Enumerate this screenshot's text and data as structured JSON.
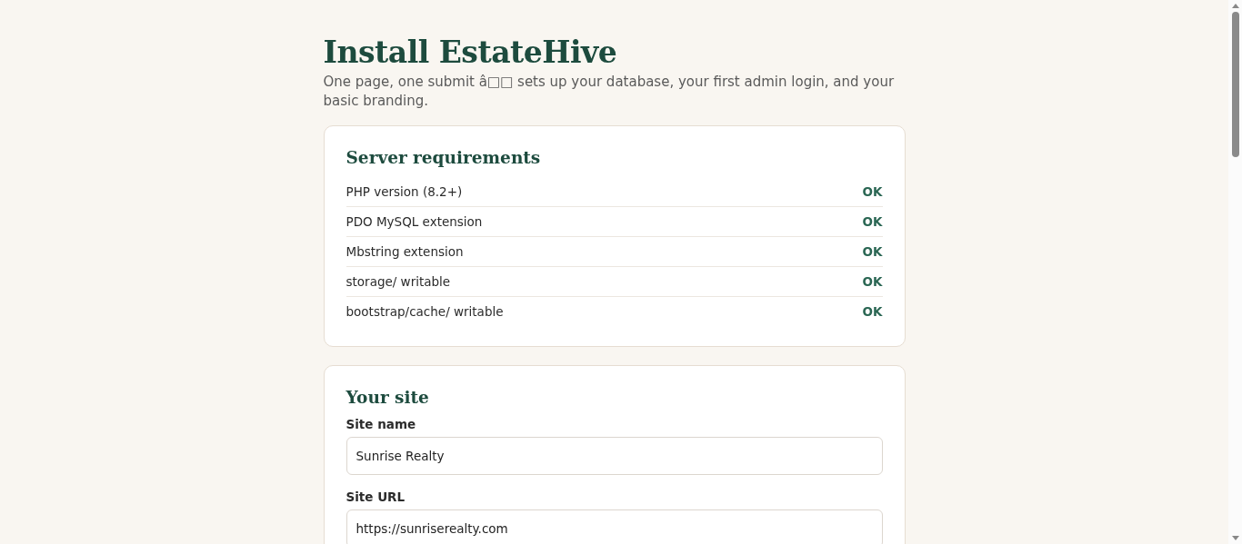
{
  "title": "Install EstateHive",
  "subtitle": "One page, one submit â□□ sets up your database, your first admin login, and your basic branding.",
  "requirements": {
    "heading": "Server requirements",
    "items": [
      {
        "name": "PHP version (8.2+)",
        "status": "OK"
      },
      {
        "name": "PDO MySQL extension",
        "status": "OK"
      },
      {
        "name": "Mbstring extension",
        "status": "OK"
      },
      {
        "name": "storage/ writable",
        "status": "OK"
      },
      {
        "name": "bootstrap/cache/ writable",
        "status": "OK"
      }
    ]
  },
  "site": {
    "heading": "Your site",
    "fields": [
      {
        "label": "Site name",
        "value": "Sunrise Realty"
      },
      {
        "label": "Site URL",
        "value": "https://sunriserealty.com"
      }
    ]
  }
}
